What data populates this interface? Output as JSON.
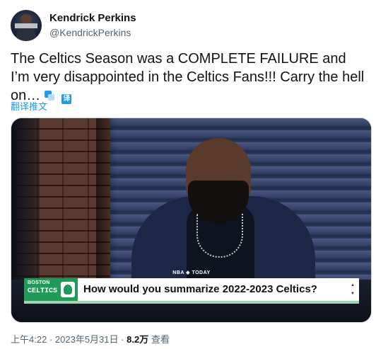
{
  "author": {
    "name": "Kendrick Perkins",
    "handle": "@KendrickPerkins"
  },
  "tweet": {
    "text": "The Celtics Season was a COMPLETE FAILURE and I’m very disappointed in the Celtics Fans!!! Carry the hell on…",
    "translate_label": "翻译推文"
  },
  "media": {
    "network_logo": "NBA ◈ TODAY",
    "lower_third": {
      "team_city": "BOSTON",
      "team_name": "CELTICS",
      "question": "How would you summarize 2022-2023 Celtics?"
    }
  },
  "meta": {
    "time": "上午4:22",
    "date": "2023年5月31日",
    "views_count": "8.2万",
    "views_label": "查看",
    "sep": "·"
  },
  "colors": {
    "accent": "#1d9bf0",
    "celtics_green": "#1e9b57",
    "secondary_text": "#536471"
  }
}
